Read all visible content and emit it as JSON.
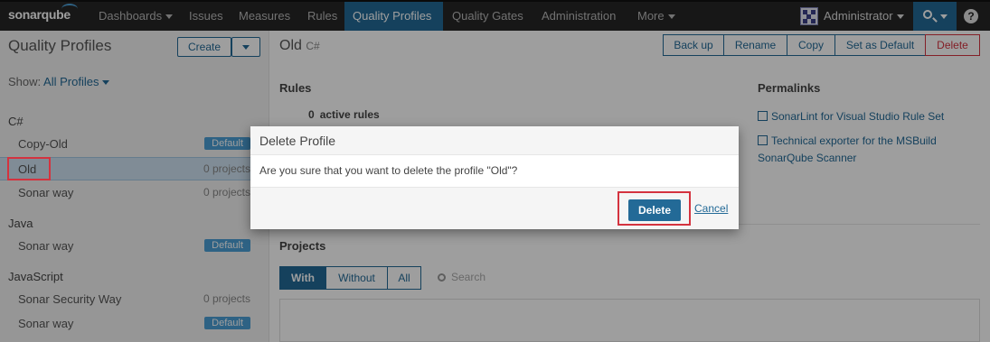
{
  "nav": {
    "logo": "sonarqube",
    "items": [
      {
        "label": "Dashboards",
        "caret": true
      },
      {
        "label": "Issues"
      },
      {
        "label": "Measures"
      },
      {
        "label": "Rules"
      },
      {
        "label": "Quality Profiles",
        "active": true
      },
      {
        "label": "Quality Gates"
      },
      {
        "label": "Administration"
      },
      {
        "label": "More",
        "caret": true
      }
    ],
    "user": "Administrator",
    "help": "?"
  },
  "sidebar": {
    "title": "Quality Profiles",
    "create_label": "Create",
    "show_prefix": "Show:",
    "show_value": "All Profiles",
    "groups": [
      {
        "language": "C#",
        "profiles": [
          {
            "name": "Copy-Old",
            "badge": "Default"
          },
          {
            "name": "Old",
            "count": "0 projects",
            "selected": true
          },
          {
            "name": "Sonar way",
            "count": "0 projects"
          }
        ]
      },
      {
        "language": "Java",
        "profiles": [
          {
            "name": "Sonar way",
            "badge": "Default"
          }
        ]
      },
      {
        "language": "JavaScript",
        "profiles": [
          {
            "name": "Sonar Security Way",
            "count": "0 projects"
          },
          {
            "name": "Sonar way",
            "badge": "Default"
          }
        ]
      }
    ]
  },
  "main": {
    "title": "Old",
    "language": "C#",
    "actions": [
      "Back up",
      "Rename",
      "Copy",
      "Set as Default",
      "Delete"
    ],
    "rules_heading": "Rules",
    "active_count": "0",
    "active_label": "active rules",
    "permalinks_heading": "Permalinks",
    "permalinks": [
      "SonarLint for Visual Studio Rule Set",
      "Technical exporter for the MSBuild",
      "SonarQube Scanner"
    ],
    "projects_heading": "Projects",
    "project_tabs": [
      "With",
      "Without",
      "All"
    ],
    "search_placeholder": "Search"
  },
  "dialog": {
    "title": "Delete Profile",
    "message": "Are you sure that you want to delete the profile \"Old\"?",
    "confirm_label": "Delete",
    "cancel_label": "Cancel"
  },
  "colors": {
    "nav_bg": "#262626",
    "accent": "#236a97",
    "danger": "#d4333f",
    "highlight_box": "#d4333f"
  }
}
